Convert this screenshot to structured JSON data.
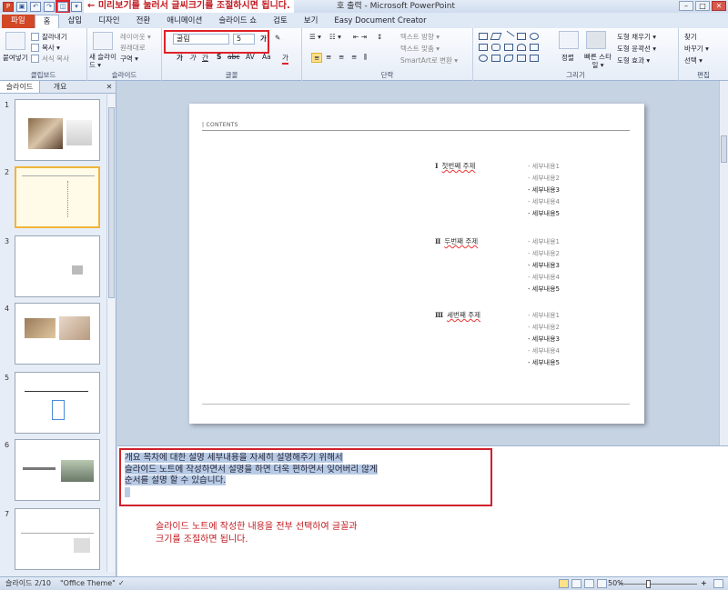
{
  "titlebar": {
    "annotation": "← 미리보기를 눌러서 글씨크기를 조절하시면 됩니다.",
    "window_title": "호 출력 - Microsoft PowerPoint",
    "min": "–",
    "max": "□",
    "close": "✕"
  },
  "tabs": [
    "파일",
    "홈",
    "삽입",
    "디자인",
    "전환",
    "애니메이션",
    "슬라이드 쇼",
    "검토",
    "보기",
    "Easy Document Creator"
  ],
  "ribbon": {
    "clipboard": {
      "paste": "붙여넣기",
      "cut": "잘라내기",
      "copy": "복사 ▾",
      "format_painter": "서식 복사",
      "label": "클립보드"
    },
    "slides": {
      "new_slide": "새 슬라이드 ▾",
      "layout": "레이아웃 ▾",
      "reset": "원래대로",
      "section": "구역 ▾",
      "label": "슬라이드"
    },
    "font": {
      "font_name": "굴림",
      "font_size": "5",
      "bold": "가",
      "italic": "가",
      "underline": "간",
      "strike": "S",
      "abc": "abc",
      "spacing": "AV",
      "case": "Aa",
      "color": "가",
      "label": "글꼴"
    },
    "paragraph": {
      "text_direction": "텍스트 방향 ▾",
      "align_text": "텍스트 맞춤 ▾",
      "smartart": "SmartArt로 변환 ▾",
      "label": "단락"
    },
    "drawing": {
      "arrange": "정렬",
      "quick_styles": "빠른 스타일 ▾",
      "fill": "도형 채우기 ▾",
      "outline": "도형 윤곽선 ▾",
      "effects": "도형 효과 ▾",
      "label": "그리기"
    },
    "editing": {
      "find": "찾기",
      "replace": "바꾸기 ▾",
      "select": "선택 ▾",
      "label": "편집"
    }
  },
  "panel": {
    "tab_slides": "슬라이드",
    "tab_outline": "개요",
    "close": "✕",
    "thumbnails": [
      {
        "num": "1"
      },
      {
        "num": "2"
      },
      {
        "num": "3"
      },
      {
        "num": "4"
      },
      {
        "num": "5"
      },
      {
        "num": "6"
      },
      {
        "num": "7"
      }
    ]
  },
  "slide": {
    "contents_label": "| CONTENTS",
    "topics": [
      {
        "roman": "Ⅰ",
        "name": "첫번째 주제",
        "details": [
          "- 세부내용1",
          "- 세부내용2",
          "- 세부내용3",
          "- 세부내용4",
          "- 세부내용5"
        ]
      },
      {
        "roman": "Ⅱ",
        "name": "두번째 주제",
        "details": [
          "- 세부내용1",
          "- 세부내용2",
          "- 세부내용3",
          "- 세부내용4",
          "- 세부내용5"
        ]
      },
      {
        "roman": "Ⅲ",
        "name": "세번째 주제",
        "details": [
          "- 세부내용1",
          "- 세부내용2",
          "- 세부내용3",
          "- 세부내용4",
          "- 세부내용5"
        ]
      }
    ]
  },
  "notes": {
    "lines": [
      "개요 목차에 대한 설명 세부내용을 자세히 설명해주기 위해서",
      "슬라이드 노트에 작성하면서 설명을 하면 더욱 편하면서 잊어버리 않게",
      "순서를 설명 할 수 있습니다."
    ],
    "annotation_lines": [
      "슬라이드 노트에 작성한 내용을 전부 선택하여 글꼴과",
      "크기를 조절하면 됩니다."
    ]
  },
  "status": {
    "slide_info": "슬라이드 2/10",
    "theme": "\"Office Theme\"",
    "zoom": "50%",
    "zoom_minus": "–",
    "zoom_plus": "+"
  },
  "colors": {
    "annotation_red": "#c0181e",
    "file_tab": "#d24726",
    "selection_border": "#f0b43a"
  }
}
